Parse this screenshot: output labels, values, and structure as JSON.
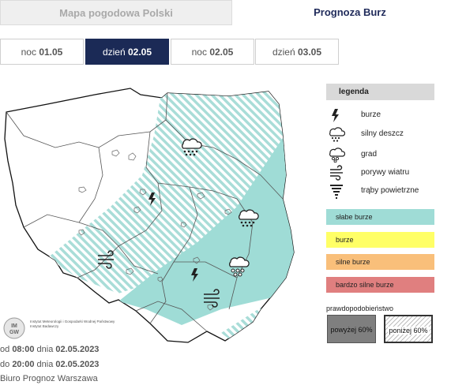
{
  "tabs": {
    "map": "Mapa pogodowa Polski",
    "storm": "Prognoza Burz"
  },
  "day_tabs": [
    {
      "prefix": "noc",
      "date": "01.05",
      "active": false
    },
    {
      "prefix": "dzień",
      "date": "02.05",
      "active": true
    },
    {
      "prefix": "noc",
      "date": "02.05",
      "active": false
    },
    {
      "prefix": "dzień",
      "date": "03.05",
      "active": false
    }
  ],
  "legend": {
    "title": "legenda",
    "items": [
      {
        "icon": "lightning-icon",
        "label": "burze"
      },
      {
        "icon": "heavy-rain-icon",
        "label": "silny deszcz"
      },
      {
        "icon": "hail-icon",
        "label": "grad"
      },
      {
        "icon": "wind-gust-icon",
        "label": "porywy wiatru"
      },
      {
        "icon": "tornado-icon",
        "label": "trąby powietrzne"
      }
    ],
    "levels": [
      {
        "label": "słabe burze",
        "color": "#9fdcd6"
      },
      {
        "label": "burze",
        "color": "#ffff66"
      },
      {
        "label": "silne burze",
        "color": "#f9bf7a"
      },
      {
        "label": "bardzo silne burze",
        "color": "#e07f7f"
      }
    ],
    "probability_title": "prawdopodobieństwo",
    "probability": [
      {
        "label": "powyżej 60%",
        "style": "solid"
      },
      {
        "label": "poniżej 60%",
        "style": "hatched"
      }
    ]
  },
  "logo": {
    "text": "IMGW",
    "institute": "Instytut Meteorologii i Gospodarki Wodnej Państwowy Instytut Badawczy"
  },
  "footer": {
    "from_prefix": "od",
    "from_time": "08:00",
    "from_mid": "dnia",
    "from_date": "02.05.2023",
    "to_prefix": "do",
    "to_time": "20:00",
    "to_mid": "dnia",
    "to_date": "02.05.2023",
    "office": "Biuro Prognoz Warszawa"
  },
  "colors": {
    "accent": "#1b2a56",
    "weak_storm": "#9fdcd6"
  }
}
